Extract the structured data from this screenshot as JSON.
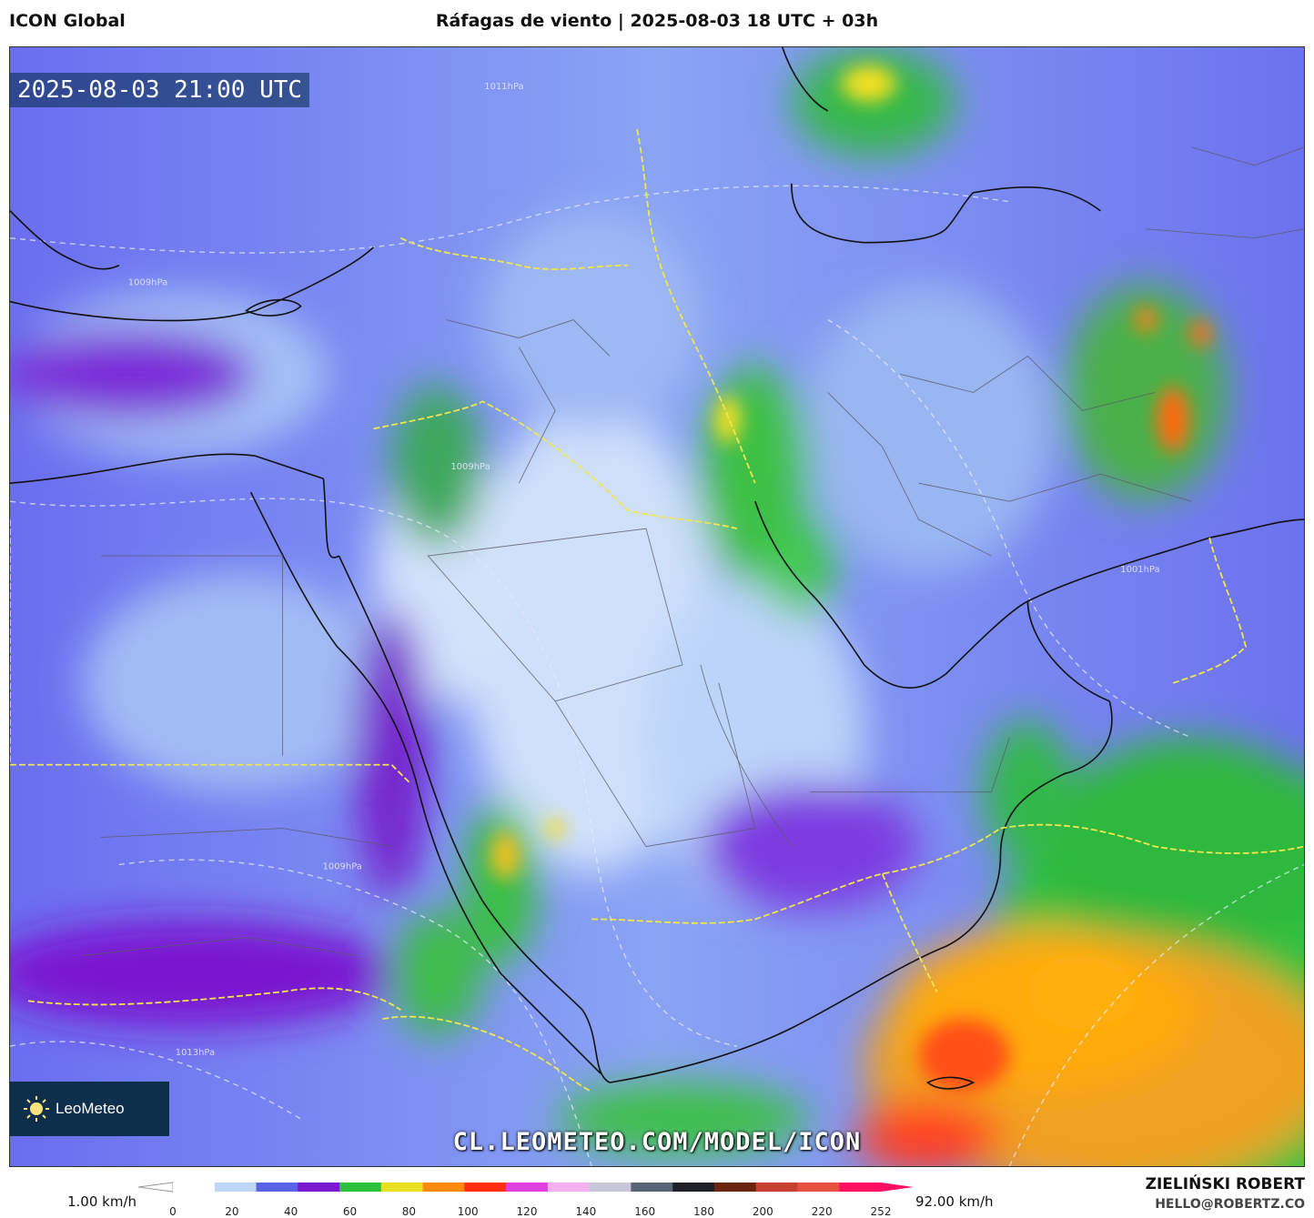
{
  "header": {
    "model_name": "ICON Global",
    "title": "Ráfagas de viento | 2025-08-03 18 UTC + 03h"
  },
  "map": {
    "valid_time": "2025-08-03 21:00 UTC",
    "watermark": "CL.LEOMETEO.COM/MODEL/ICON",
    "logo_text": "LeoMeteo",
    "pressure_labels": [
      "1011hPa",
      "1009hPa",
      "1009hPa",
      "1009hPa",
      "1013hPa",
      "1001hPa"
    ]
  },
  "legend": {
    "min_label": "1.00 km/h",
    "max_label": "92.00 km/h",
    "ticks": [
      "0",
      "20",
      "40",
      "60",
      "80",
      "100",
      "120",
      "140",
      "160",
      "180",
      "200",
      "220",
      "252"
    ],
    "colors": [
      "#ffffff",
      "#c0d6f8",
      "#5a62e6",
      "#7a18d0",
      "#2ec23a",
      "#e8e020",
      "#ff8a10",
      "#ff3010",
      "#e040e0",
      "#f4b0f0",
      "#c8c8d8",
      "#5a6478",
      "#202028",
      "#6a2410",
      "#c84030",
      "#e85040",
      "#ff1060"
    ]
  },
  "credits": {
    "author": "ZIELIŃSKI ROBERT",
    "email": "HELLO@ROBERTZ.CO"
  }
}
